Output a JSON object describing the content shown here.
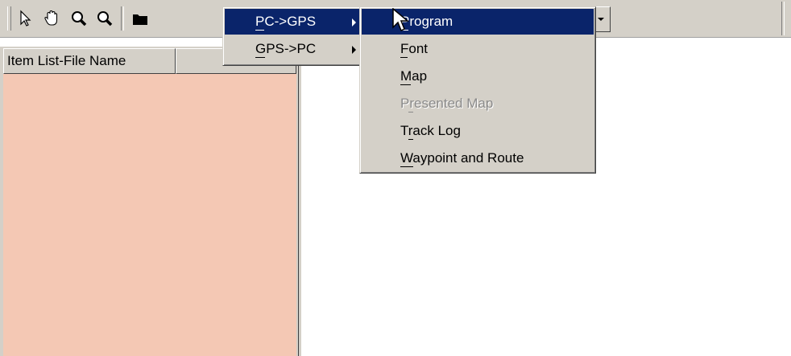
{
  "toolbar": {
    "buttons": [
      {
        "icon": "select-arrow-icon"
      },
      {
        "icon": "hand-pan-icon"
      },
      {
        "icon": "zoom-in-icon"
      },
      {
        "icon": "zoom-out-icon"
      },
      {
        "icon": "folder-icon"
      }
    ]
  },
  "list_panel": {
    "columns": [
      "Item List-File Name",
      ""
    ],
    "background_color": "#f4c8b4"
  },
  "menu": {
    "level1": [
      {
        "label": "PC->GPS",
        "mnemonic": "P",
        "selected": true,
        "has_submenu": true
      },
      {
        "label": "GPS->PC",
        "mnemonic": "G",
        "selected": false,
        "has_submenu": true
      }
    ],
    "level2": [
      {
        "label": "Program",
        "mnemonic": "P",
        "selected": true,
        "enabled": true
      },
      {
        "label": "Font",
        "mnemonic": "F",
        "selected": false,
        "enabled": true
      },
      {
        "label": "Map",
        "mnemonic": "M",
        "selected": false,
        "enabled": true
      },
      {
        "label": "Presented Map",
        "mnemonic": "r",
        "selected": false,
        "enabled": false
      },
      {
        "label": "Track Log",
        "mnemonic": "r",
        "selected": false,
        "enabled": true
      },
      {
        "label": "Waypoint and Route",
        "mnemonic": "W",
        "selected": false,
        "enabled": true
      }
    ],
    "highlight_color": "#0a246a"
  }
}
